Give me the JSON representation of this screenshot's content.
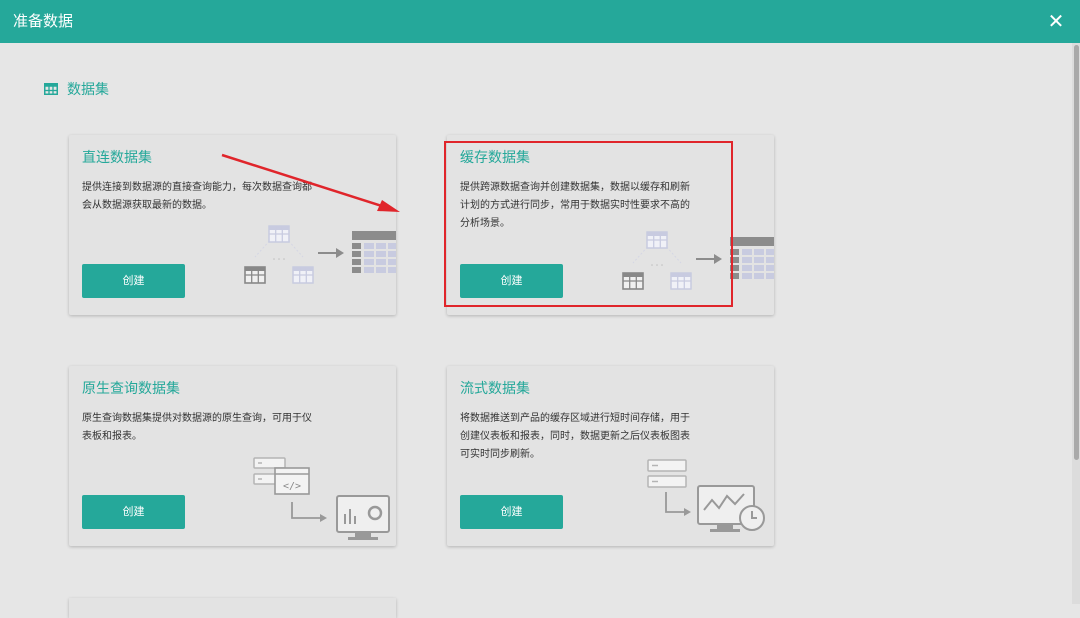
{
  "header": {
    "title": "准备数据",
    "close_icon": "close-icon",
    "close_glyph": "✕",
    "background_color": "#25a89a"
  },
  "section": {
    "title": "数据集",
    "icon": "table-icon"
  },
  "cards": [
    {
      "title": "直连数据集",
      "desc_lines": [
        "提供连接到数据源的直接查询能力，每次数据查询都",
        "会从数据源获取最新的数据。"
      ],
      "button_label": "创建",
      "illustration_icon": "datasets-to-table-icon"
    },
    {
      "title": "缓存数据集",
      "desc_lines": [
        "提供跨源数据查询并创建数据集，数据以缓存和刷新",
        "计划的方式进行同步，常用于数据实时性要求不高的",
        "分析场景。"
      ],
      "button_label": "创建",
      "illustration_icon": "datasets-to-table-icon"
    },
    {
      "title": "原生查询数据集",
      "desc_lines": [
        "原生查询数据集提供对数据源的原生查询，可用于仪",
        "表板和报表。"
      ],
      "button_label": "创建",
      "illustration_icon": "server-code-to-monitor-icon"
    },
    {
      "title": "流式数据集",
      "desc_lines": [
        "将数据推送到产品的缓存区域进行短时间存储，用于",
        "创建仪表板和报表，同时，数据更新之后仪表板图表",
        "可实时同步刷新。"
      ],
      "button_label": "创建",
      "illustration_icon": "server-to-monitor-clock-icon"
    }
  ],
  "annotation": {
    "color": "#e0252b",
    "arrow_icon": "red-arrow-annotation",
    "box": "red-highlight-box"
  },
  "colors": {
    "accent": "#25a89a",
    "background": "#e6e6e6",
    "card": "#e3e3e3",
    "illustration_dark": "#8c8c8c",
    "illustration_light": "#c8cbe0"
  }
}
